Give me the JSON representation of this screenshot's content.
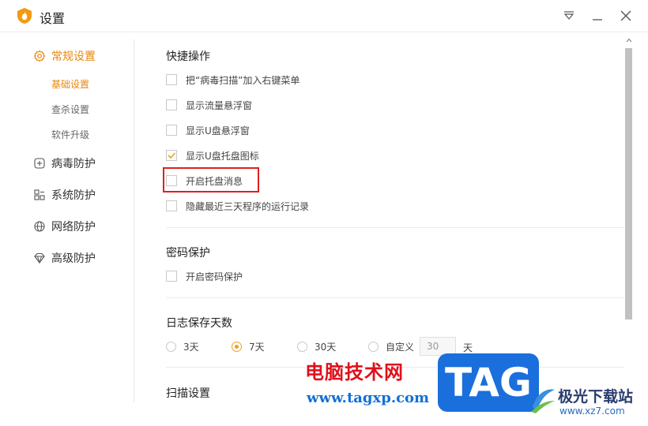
{
  "window": {
    "title": "设置",
    "logo_icon": "flame-shield-icon",
    "accent_color": "#e8860d"
  },
  "sidebar": {
    "items": [
      {
        "label": "常规设置",
        "icon": "gear-icon",
        "active": true
      },
      {
        "label": "病毒防护",
        "icon": "plus-square-icon"
      },
      {
        "label": "系统防护",
        "icon": "modules-icon"
      },
      {
        "label": "网络防护",
        "icon": "globe-icon"
      },
      {
        "label": "高级防护",
        "icon": "diamond-icon"
      }
    ],
    "sub_items": [
      {
        "label": "基础设置",
        "active": true
      },
      {
        "label": "查杀设置"
      },
      {
        "label": "软件升级"
      }
    ]
  },
  "content": {
    "quick_ops": {
      "title": "快捷操作",
      "options": [
        {
          "label": "把“病毒扫描”加入右键菜单",
          "checked": false
        },
        {
          "label": "显示流量悬浮窗",
          "checked": false
        },
        {
          "label": "显示U盘悬浮窗",
          "checked": false
        },
        {
          "label": "显示U盘托盘图标",
          "checked": true
        },
        {
          "label": "开启托盘消息",
          "checked": false
        },
        {
          "label": "隐藏最近三天程序的运行记录",
          "checked": false
        }
      ]
    },
    "password": {
      "title": "密码保护",
      "options": [
        {
          "label": "开启密码保护",
          "checked": false
        }
      ]
    },
    "log_days": {
      "title": "日志保存天数",
      "radios": [
        {
          "label": "3天",
          "selected": false
        },
        {
          "label": "7天",
          "selected": true
        },
        {
          "label": "30天",
          "selected": false
        },
        {
          "label": "自定义",
          "selected": false
        }
      ],
      "custom_value": "30",
      "custom_unit": "天"
    },
    "scan": {
      "title": "扫描设置"
    }
  },
  "watermark": {
    "site_name": "电脑技术网",
    "site_url": "www.tagxp.com",
    "badge": "TAG",
    "brand_name": "极光下载站",
    "brand_url": "www.xz7.com"
  }
}
